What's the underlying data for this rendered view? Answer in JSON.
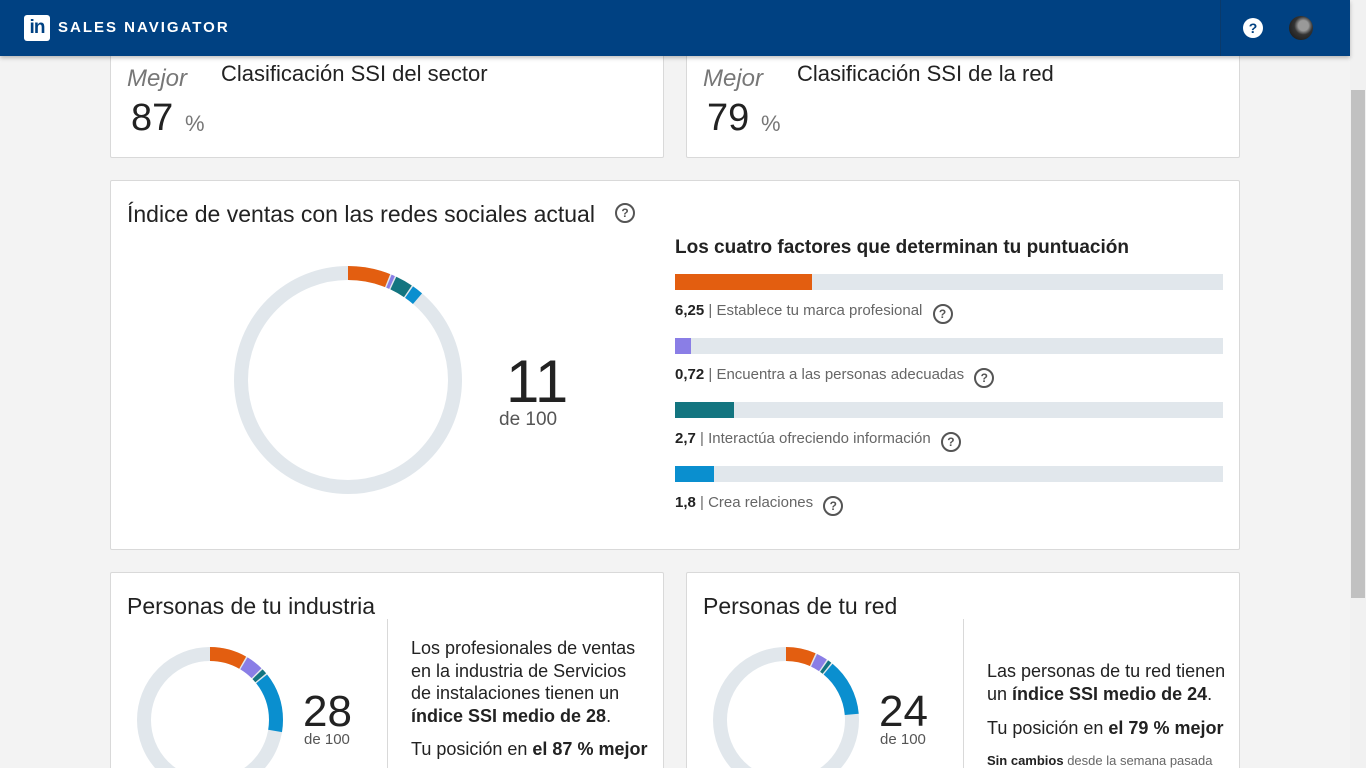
{
  "header": {
    "logo": "in",
    "brand": "SALES NAVIGATOR",
    "help_icon": "help-icon",
    "avatar_icon": "user-avatar"
  },
  "rank_industry": {
    "label": "Mejor",
    "value": "87",
    "unit": "%",
    "title": "Clasificación SSI del sector"
  },
  "rank_network": {
    "label": "Mejor",
    "value": "79",
    "unit": "%",
    "title": "Clasificación SSI de la red"
  },
  "ssi": {
    "title": "Índice de ventas con las redes sociales actual",
    "score": "11",
    "of": "de 100",
    "factors_title": "Los cuatro factores que determinan tu puntuación",
    "factors": [
      {
        "value": "6,25",
        "label": "Establece tu marca profesional",
        "score": 6.25,
        "max": 25,
        "color": "#e35e10"
      },
      {
        "value": "0,72",
        "label": "Encuentra a las personas adecuadas",
        "score": 0.72,
        "max": 25,
        "color": "#8a7ee6"
      },
      {
        "value": "2,7",
        "label": "Interactúa ofreciendo información",
        "score": 2.7,
        "max": 25,
        "color": "#137580"
      },
      {
        "value": "1,8",
        "label": "Crea relaciones",
        "score": 1.8,
        "max": 25,
        "color": "#0a8fcf"
      }
    ]
  },
  "industry": {
    "title": "Personas de tu industria",
    "score": "28",
    "of": "de 100",
    "text_lines": [
      "Los profesionales de ventas",
      "en la industria de Servicios",
      "de instalaciones tienen un"
    ],
    "text_bold": "índice SSI medio de 28",
    "text_end": ".",
    "pos_prefix": "Tu posición en ",
    "pos_bold": "el 87 % mejor",
    "segments": [
      8.6,
      4.2,
      1.5,
      13.7
    ]
  },
  "network": {
    "title": "Personas de tu red",
    "score": "24",
    "of": "de 100",
    "text_line": "Las personas de tu red tienen",
    "text_prefix": "un ",
    "text_bold": "índice SSI medio de 24",
    "text_end": ".",
    "pos_prefix": "Tu posición en ",
    "pos_bold": "el 79 % mejor",
    "change_bold": "Sin cambios",
    "change_text": " desde la semana pasada",
    "segments": [
      7.0,
      2.8,
      1.2,
      13.0
    ]
  },
  "colors": {
    "brand": "#004182",
    "track": "#e1e7ec",
    "orange": "#e35e10",
    "purple": "#8a7ee6",
    "teal": "#137580",
    "blue": "#0a8fcf"
  }
}
